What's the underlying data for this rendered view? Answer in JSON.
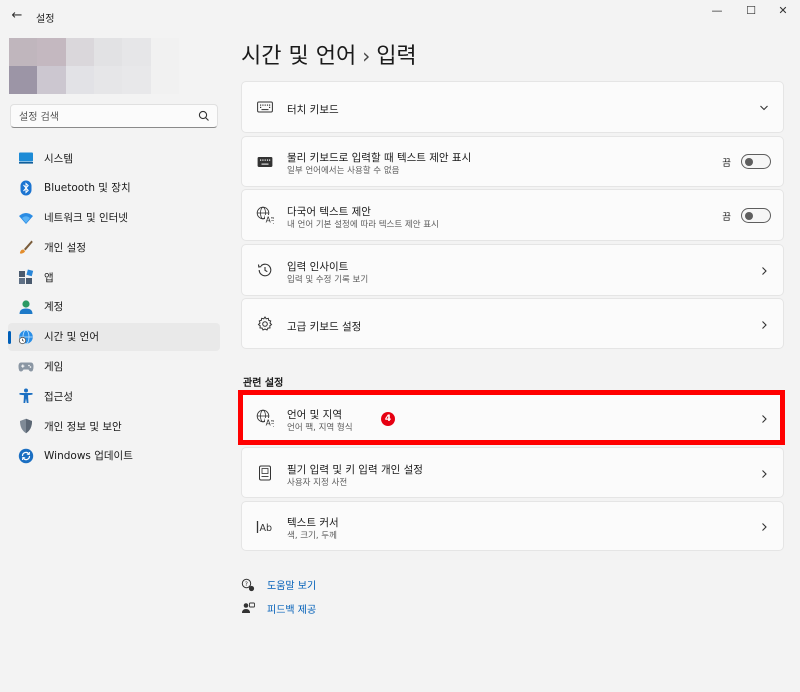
{
  "window": {
    "title": "설정",
    "minimize_glyph": "—",
    "maximize_glyph": "☐",
    "close_glyph": "✕",
    "back_glyph": "←"
  },
  "sidebar": {
    "search_placeholder": "설정 검색",
    "avatar_colors": [
      "#c0b6bd",
      "#c4b8c0",
      "#dad7db",
      "#e2e2e4",
      "#e6e6e8",
      "#f1f1f1",
      "#9c95a6",
      "#ccc7d0",
      "#e2e2e6",
      "#e6e6e8",
      "#e8e8ea",
      "#f1f1f1"
    ],
    "items": [
      {
        "label": "시스템",
        "icon": "monitor-icon",
        "active": false
      },
      {
        "label": "Bluetooth 및 장치",
        "icon": "bluetooth-icon",
        "active": false
      },
      {
        "label": "네트워크 및 인터넷",
        "icon": "wifi-icon",
        "active": false
      },
      {
        "label": "개인 설정",
        "icon": "paintbrush-icon",
        "active": false
      },
      {
        "label": "앱",
        "icon": "apps-icon",
        "active": false
      },
      {
        "label": "계정",
        "icon": "person-icon",
        "active": false
      },
      {
        "label": "시간 및 언어",
        "icon": "globe-clock-icon",
        "active": true
      },
      {
        "label": "게임",
        "icon": "gamepad-icon",
        "active": false
      },
      {
        "label": "접근성",
        "icon": "accessibility-icon",
        "active": false
      },
      {
        "label": "개인 정보 및 보안",
        "icon": "shield-icon",
        "active": false
      },
      {
        "label": "Windows 업데이트",
        "icon": "update-icon",
        "active": false
      }
    ]
  },
  "breadcrumb": {
    "parent": "시간 및 언어",
    "separator": "›",
    "current": "입력"
  },
  "cards": {
    "touch_keyboard": {
      "title": "터치 키보드"
    },
    "hw_suggestions": {
      "title": "물리 키보드로 입력할 때 텍스트 제안 표시",
      "subtitle": "일부 언어에서는 사용할 수 없음",
      "toggle_label": "끔"
    },
    "multilingual": {
      "title": "다국어 텍스트 제안",
      "subtitle": "내 언어 기본 설정에 따라 텍스트 제안 표시",
      "toggle_label": "끔"
    },
    "insights": {
      "title": "입력 인사이트",
      "subtitle": "입력 및 수정 기록 보기"
    },
    "advanced": {
      "title": "고급 키보드 설정"
    }
  },
  "related": {
    "header": "관련 설정",
    "language_region": {
      "title": "언어 및 지역",
      "subtitle": "언어 팩, 지역 형식"
    },
    "pen_input": {
      "title": "필기 입력 및 키 입력 개인 설정",
      "subtitle": "사용자 지정 사전"
    },
    "text_cursor": {
      "title": "텍스트 커서",
      "subtitle": "색, 크기, 두께"
    }
  },
  "annotation": {
    "badge": "4",
    "highlight_color": "#ff0000"
  },
  "footer": {
    "help": "도움말 보기",
    "feedback": "피드백 제공"
  },
  "colors": {
    "accent": "#005fb8",
    "background": "#f3f3f3",
    "card": "#fbfbfb"
  }
}
